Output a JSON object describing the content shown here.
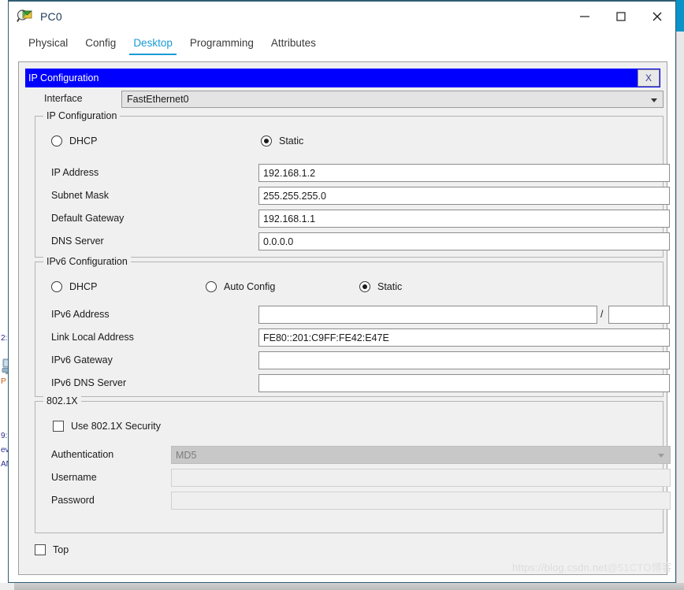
{
  "window": {
    "title": "PC0",
    "icon": "packet-tracer-pc-icon",
    "minimize_label": "—",
    "maximize_label": "□",
    "close_label": "✕"
  },
  "tabs": [
    {
      "label": "Physical",
      "active": false
    },
    {
      "label": "Config",
      "active": false
    },
    {
      "label": "Desktop",
      "active": true
    },
    {
      "label": "Programming",
      "active": false
    },
    {
      "label": "Attributes",
      "active": false
    }
  ],
  "dialog": {
    "title": "IP Configuration",
    "close_label": "X",
    "accent_color": "#0000ff"
  },
  "interface": {
    "label": "Interface",
    "value": "FastEthernet0"
  },
  "ipv4": {
    "legend": "IP Configuration",
    "dhcp_label": "DHCP",
    "static_label": "Static",
    "selected": "static",
    "fields": [
      {
        "label": "IP Address",
        "value": "192.168.1.2"
      },
      {
        "label": "Subnet Mask",
        "value": "255.255.255.0"
      },
      {
        "label": "Default Gateway",
        "value": "192.168.1.1"
      },
      {
        "label": "DNS Server",
        "value": "0.0.0.0"
      }
    ]
  },
  "ipv6": {
    "legend": "IPv6 Configuration",
    "dhcp_label": "DHCP",
    "auto_config_label": "Auto Config",
    "static_label": "Static",
    "selected": "static",
    "prefix_separator": "/",
    "prefix_value": "",
    "fields": [
      {
        "label": "IPv6 Address",
        "value": ""
      },
      {
        "label": "Link Local Address",
        "value": "FE80::201:C9FF:FE42:E47E"
      },
      {
        "label": "IPv6 Gateway",
        "value": ""
      },
      {
        "label": "IPv6 DNS Server",
        "value": ""
      }
    ]
  },
  "dot1x": {
    "legend": "802.1X",
    "use_security_label": "Use 802.1X Security",
    "use_security_checked": false,
    "authentication_label": "Authentication",
    "authentication_value": "MD5",
    "username_label": "Username",
    "username_value": "",
    "password_label": "Password",
    "password_value": ""
  },
  "footer": {
    "top_label": "Top",
    "top_checked": false
  },
  "watermark": {
    "url": "https://blog.csdn.net",
    "tag": "@51CTO博客"
  },
  "background": {
    "strip_texts": [
      "2:",
      "P",
      "9:",
      "ev",
      "AN"
    ]
  }
}
